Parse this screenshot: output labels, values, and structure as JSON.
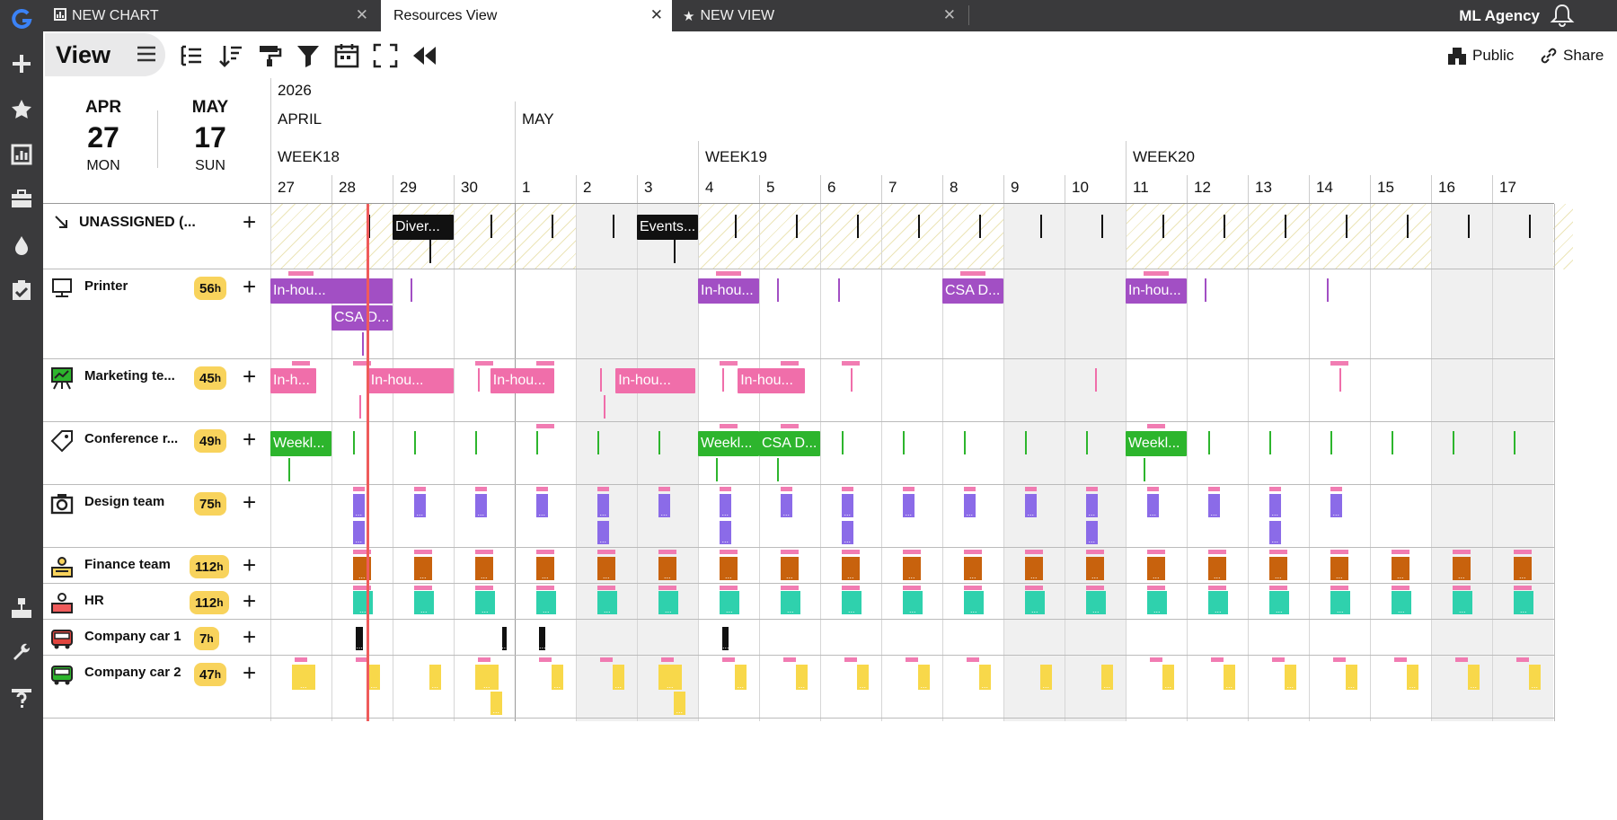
{
  "rail": {
    "items": [
      {
        "name": "logo-icon",
        "glyph": "G"
      },
      {
        "name": "add-icon",
        "glyph": "+"
      },
      {
        "name": "star-icon",
        "glyph": "★"
      },
      {
        "name": "report-icon",
        "glyph": "▤"
      },
      {
        "name": "briefcase-icon",
        "glyph": "▭"
      },
      {
        "name": "drop-icon",
        "glyph": "●"
      },
      {
        "name": "checklist-icon",
        "glyph": "☑"
      },
      {
        "name": "org-chart-icon",
        "glyph": "▣"
      },
      {
        "name": "wrench-icon",
        "glyph": "✎"
      },
      {
        "name": "help-icon",
        "glyph": "?"
      }
    ]
  },
  "tabs": [
    {
      "label": "NEW CHART",
      "icon": "chart-icon",
      "active": false
    },
    {
      "label": "Resources View",
      "icon": "",
      "active": true
    },
    {
      "label": "NEW VIEW",
      "icon": "star-icon",
      "active": false
    }
  ],
  "header": {
    "agency": "ML Agency"
  },
  "toolbar": {
    "view_label": "View",
    "public_label": "Public",
    "share_label": "Share"
  },
  "date_range": {
    "start": {
      "month": "APR",
      "day": "27",
      "weekday": "MON"
    },
    "end": {
      "month": "MAY",
      "day": "17",
      "weekday": "SUN"
    }
  },
  "timeline": {
    "year": "2026",
    "months": [
      {
        "label": "APRIL",
        "start": 0
      },
      {
        "label": "MAY",
        "start": 4
      }
    ],
    "weeks": [
      {
        "label": "WEEK18",
        "start": 0
      },
      {
        "label": "WEEK19",
        "start": 7
      },
      {
        "label": "WEEK20",
        "start": 14
      }
    ],
    "days": [
      "27",
      "28",
      "29",
      "30",
      "1",
      "2",
      "3",
      "4",
      "5",
      "6",
      "7",
      "8",
      "9",
      "10",
      "11",
      "12",
      "13",
      "14",
      "15",
      "16",
      "17"
    ],
    "weekend_indices": [
      5,
      6,
      12,
      13,
      19,
      20
    ]
  },
  "resources": [
    {
      "name": "UNASSIGNED (...",
      "hours": "",
      "icon": "arrow-icon",
      "key": "unassigned"
    },
    {
      "name": "Printer",
      "hours": "56",
      "icon": "printer-icon",
      "key": "printer"
    },
    {
      "name": "Marketing te...",
      "hours": "45",
      "icon": "presentation-icon",
      "key": "marketing"
    },
    {
      "name": "Conference r...",
      "hours": "49",
      "icon": "tag-icon",
      "key": "conference"
    },
    {
      "name": "Design team",
      "hours": "75",
      "icon": "camera-icon",
      "key": "design"
    },
    {
      "name": "Finance team",
      "hours": "112",
      "icon": "finance-icon",
      "key": "finance"
    },
    {
      "name": "HR",
      "hours": "112",
      "icon": "hr-icon",
      "key": "hr"
    },
    {
      "name": "Company car 1",
      "hours": "7",
      "icon": "bus-red-icon",
      "key": "car1"
    },
    {
      "name": "Company car 2",
      "hours": "47",
      "icon": "bus-green-icon",
      "key": "car2"
    }
  ],
  "hours_unit": "h",
  "events": {
    "unassigned": [
      "Diver...",
      "Events..."
    ],
    "printer": [
      "In-hou...",
      "CSA D...",
      "In-hou...",
      "CSA D...",
      "In-hou..."
    ],
    "marketing": [
      "In-h...",
      "In-hou...",
      "In-hou...",
      "In-hou...",
      "In-hou..."
    ],
    "conference": [
      "Weekl...",
      "Weekl...",
      "CSA D...",
      "Weekl..."
    ]
  },
  "more_label": "...",
  "colors": {
    "printer": "#a24fc4",
    "marketing": "#f06eaa",
    "conference": "#2db52d",
    "design": "#8b6be8",
    "finance": "#c8620d",
    "hr": "#2fd1ad",
    "car1": "#111111",
    "car2": "#f8d84a",
    "unassigned": "#111111",
    "today": "#ef5b5b"
  }
}
